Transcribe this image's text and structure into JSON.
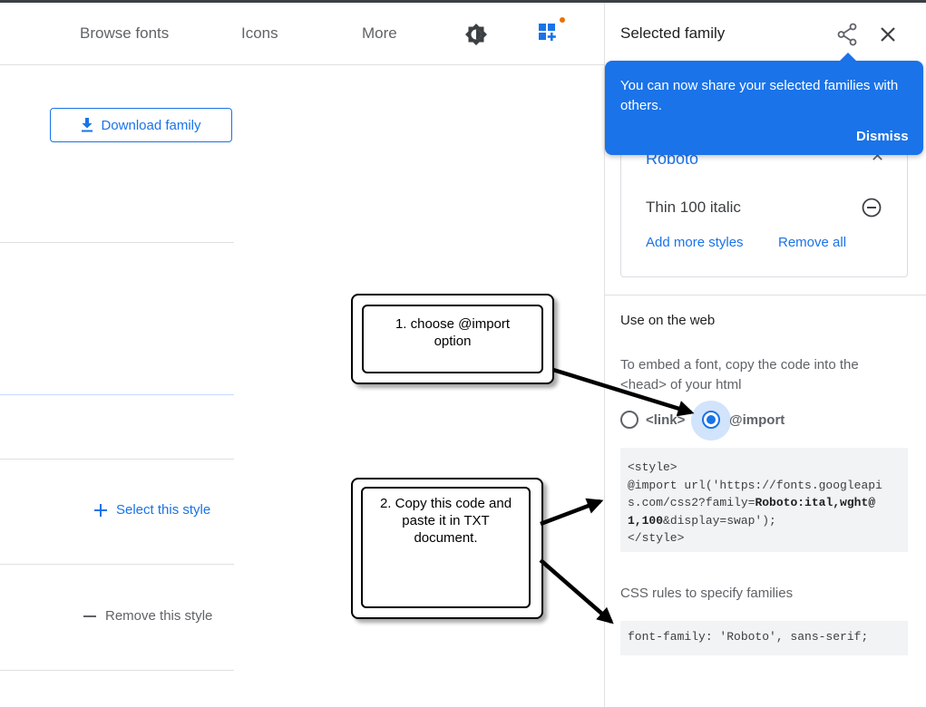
{
  "nav": {
    "browse_fonts": "Browse fonts",
    "icons": "Icons",
    "more": "More"
  },
  "left": {
    "download_family": "Download family",
    "select_style": "Select this style",
    "remove_style": "Remove this style"
  },
  "panel": {
    "title": "Selected family",
    "tooltip": {
      "text": "You can now share your selected families with others.",
      "dismiss": "Dismiss"
    },
    "family": {
      "name": "Roboto",
      "style": "Thin 100 italic",
      "add_more_styles": "Add more styles",
      "remove_all": "Remove all"
    },
    "use_on_web": "Use on the web",
    "embed_instructions": "To embed a font, copy the code into the <head> of your html",
    "radio_link_label": "<link>",
    "radio_import_label": "@import",
    "selected_option": "@import",
    "code": {
      "line1": "<style>",
      "line2a": "@import url('https://fonts.googleapi",
      "line3a": "s.com/css2?family=",
      "line3b": "Roboto:ital,wght@",
      "line4a": "1,100",
      "line4b": "&display=swap');",
      "line5": "</style>"
    },
    "css_rules_title": "CSS rules to specify families",
    "css_rule": "font-family: 'Roboto', sans-serif;"
  },
  "callouts": {
    "step1_line1": "1. choose @import",
    "step1_line2": "option",
    "step2_line1": "2. Copy this code and",
    "step2_line2": "paste it in TXT",
    "step2_line3": "document."
  },
  "colors": {
    "accent": "#1a73e8",
    "text": "#3c4043",
    "code_bg": "#f1f3f4",
    "notification_dot": "#e8710a"
  }
}
